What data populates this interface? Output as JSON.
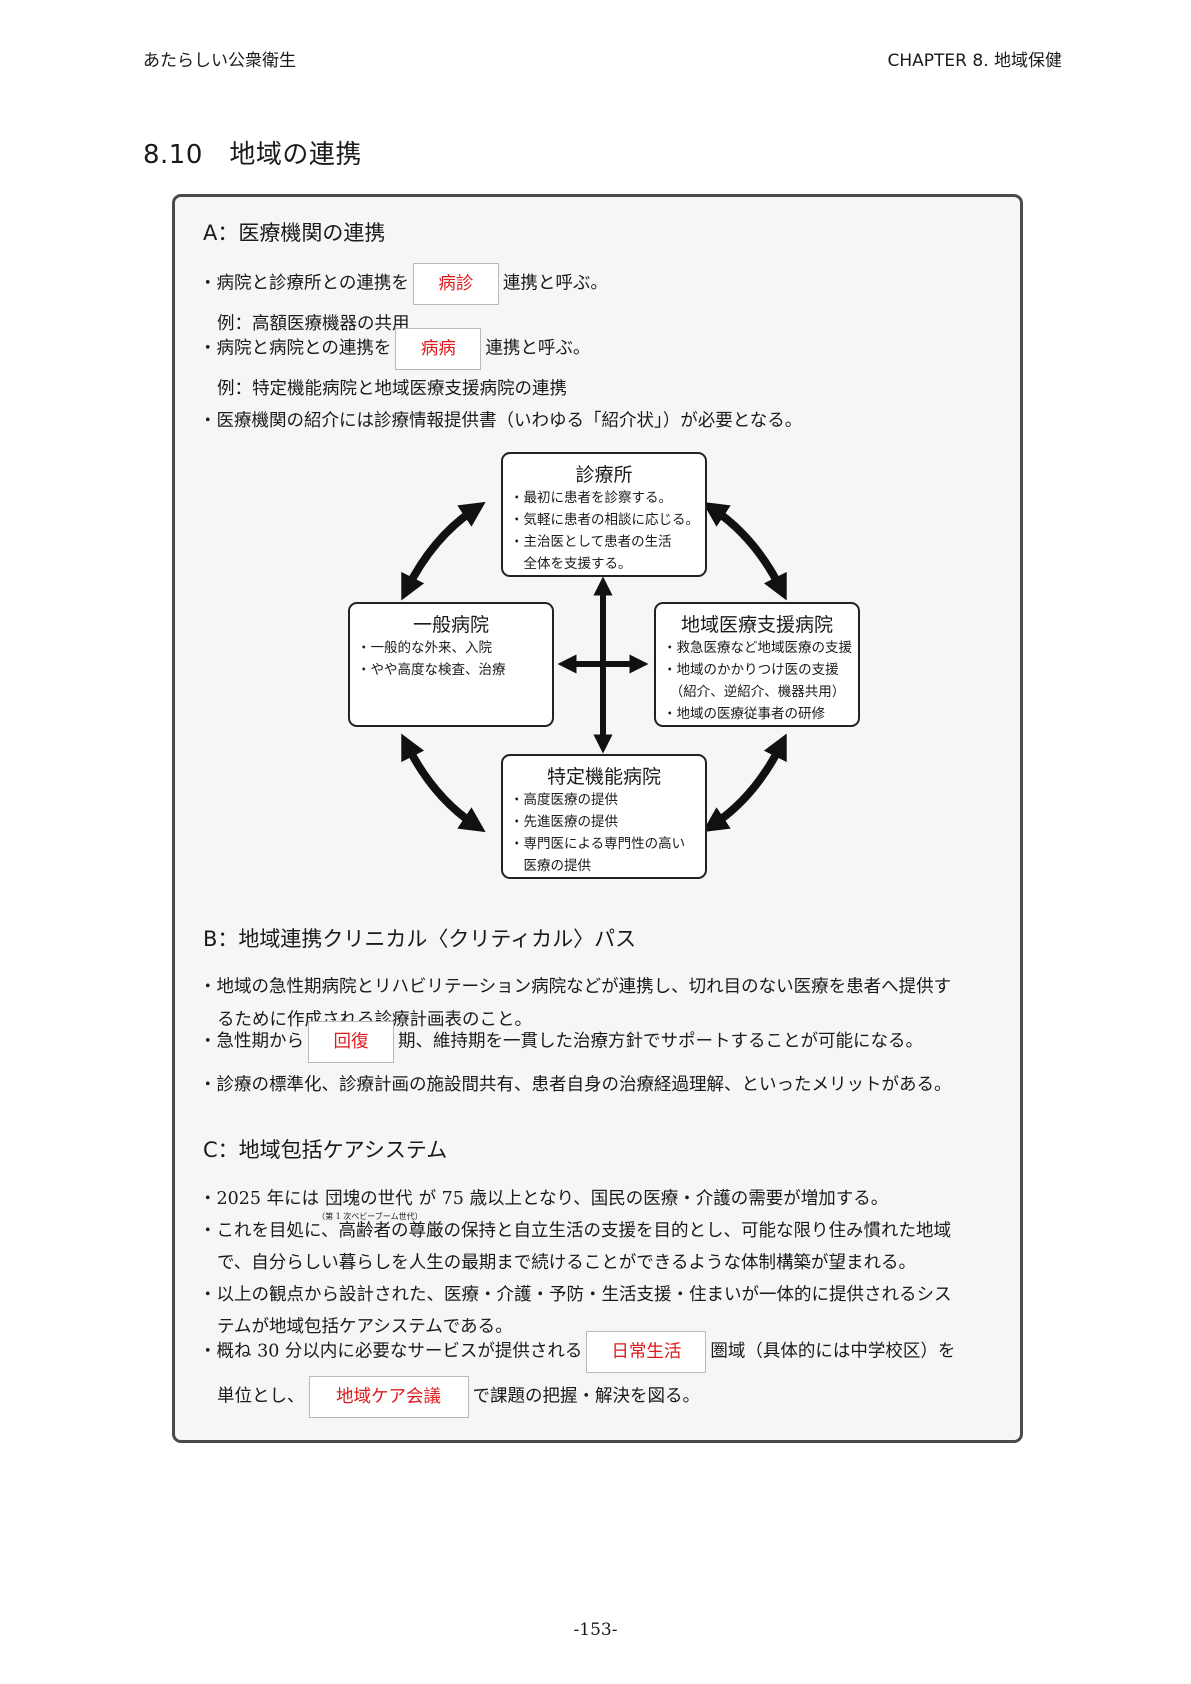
{
  "header": {
    "left": "あたらしい公衆衛生",
    "right": "CHAPTER  8.  地域保健"
  },
  "section_title": "8.10　地域の連携",
  "a": {
    "title": "A：医療機関の連携",
    "l1_pre": "・病院と診療所との連携を",
    "l1_ans": "病診",
    "l1_post": "連携と呼ぶ。",
    "l2": "例：高額医療機器の共用",
    "l3_pre": "・病院と病院との連携を",
    "l3_ans": "病病",
    "l3_post": "連携と呼ぶ。",
    "l4": "例：特定機能病院と地域医療支援病院の連携",
    "l5": "・医療機関の紹介には診療情報提供書（いわゆる「紹介状」）が必要となる。"
  },
  "diagram": {
    "clinic": {
      "title": "診療所",
      "items": [
        "・最初に患者を診察する。",
        "・気軽に患者の相談に応じる。",
        "・主治医として患者の生活",
        "　全体を支援する。"
      ]
    },
    "general": {
      "title": "一般病院",
      "items": [
        "・一般的な外来、入院",
        "・やや高度な検査、治療"
      ]
    },
    "regional": {
      "title": "地域医療支援病院",
      "items": [
        "・救急医療など地域医療の支援",
        "・地域のかかりつけ医の支援",
        "　（紹介、逆紹介、機器共用）",
        "・地域の医療従事者の研修"
      ]
    },
    "special": {
      "title": "特定機能病院",
      "items": [
        "・高度医療の提供",
        "・先進医療の提供",
        "・専門医による専門性の高い",
        "　医療の提供"
      ]
    }
  },
  "b": {
    "title": "B：地域連携クリニカル〈クリティカル〉パス",
    "l1": "・地域の急性期病院とリハビリテーション病院などが連携し、切れ目のない医療を患者へ提供す",
    "l2": "るために作成される診療計画表のこと。",
    "l3_pre": "・急性期から",
    "l3_ans": "回復",
    "l3_post": "期、維持期を一貫した治療方針でサポートすることが可能になる。",
    "l4": "・診療の標準化、診療計画の施設間共有、患者自身の治療経過理解、といったメリットがある。"
  },
  "c": {
    "title": "C：地域包括ケアシステム",
    "l1_pre": "・2025 年には",
    "l1_ruby": "団塊の世代",
    "l1_rt": "（第 1 次ベビーブーム世代）",
    "l1_post": "が 75 歳以上となり、国民の医療・介護の需要が増加する。",
    "l2": "・これを目処に、高齢者の尊厳の保持と自立生活の支援を目的とし、可能な限り住み慣れた地域",
    "l3": "で、自分らしい暮らしを人生の最期まで続けることができるような体制構築が望まれる。",
    "l4": "・以上の観点から設計された、医療・介護・予防・生活支援・住まいが一体的に提供されるシス",
    "l5": "テムが地域包括ケアシステムである。",
    "l6_pre": "・概ね 30 分以内に必要なサービスが提供される",
    "l6_ans": "日常生活",
    "l6_post": "圏域（具体的には中学校区）を",
    "l7_pre": "単位とし、",
    "l7_ans": "地域ケア会議",
    "l7_post": "で課題の把握・解決を図る。"
  },
  "page_number": "-153-"
}
